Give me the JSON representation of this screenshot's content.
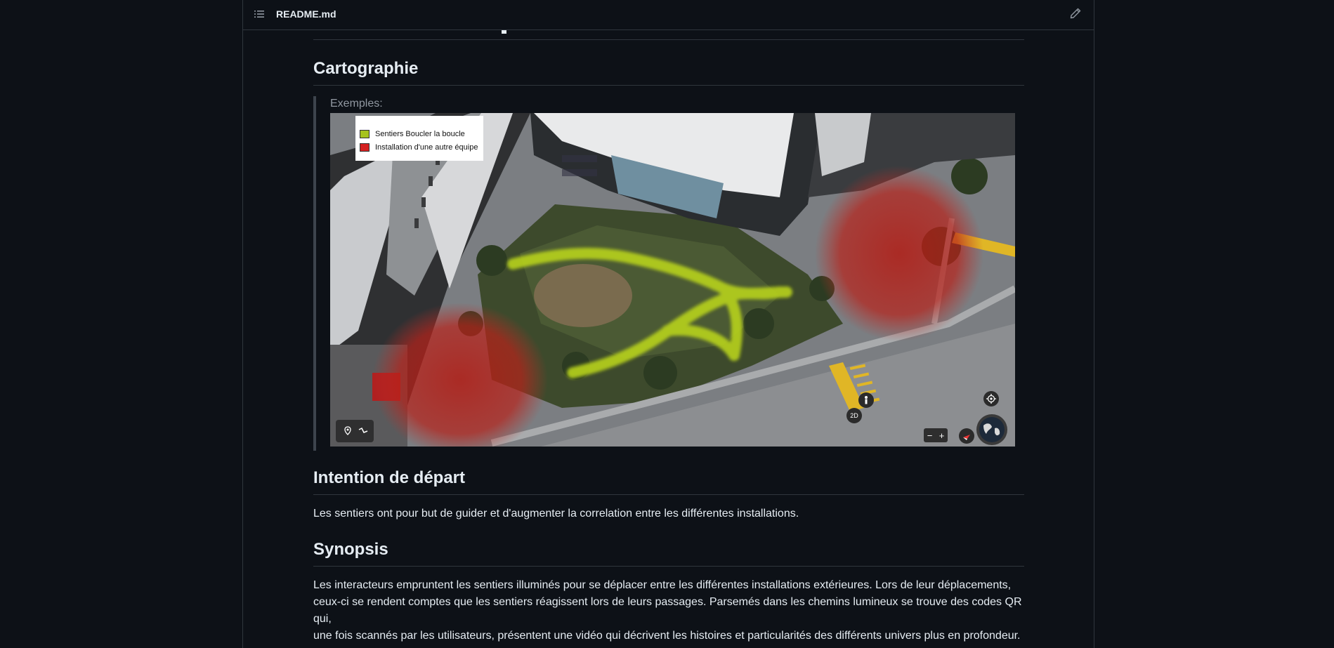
{
  "file_header": {
    "file_name": "README.md",
    "toc_icon": "list-icon",
    "edit_icon": "pencil-icon"
  },
  "sections": {
    "cartographie": {
      "title": "Cartographie",
      "quote_label": "Exemples:",
      "legend": [
        {
          "label": "Sentiers Boucler la boucle",
          "color": "#a6c21c"
        },
        {
          "label": "Installation d'une autre équipe",
          "color": "#d42020"
        }
      ],
      "map_controls": {
        "zoom_out": "−",
        "zoom_in": "+",
        "view_2d": "2D"
      }
    },
    "intention": {
      "title": "Intention de départ",
      "text": "Les sentiers ont pour but de guider et d'augmenter la correlation entre les différentes installations."
    },
    "synopsis": {
      "title": "Synopsis",
      "lines": [
        "Les interacteurs empruntent les sentiers illuminés pour se déplacer entre les différentes installations extérieures. Lors de leur déplacements,",
        "ceux-ci se rendent comptes que les sentiers réagissent lors de leurs passages. Parsemés dans les chemins lumineux se trouve des codes QR qui,",
        "une fois scannés par les utilisateurs, présentent une vidéo qui décrivent les histoires et particularités des différents univers plus en profondeur."
      ]
    }
  }
}
